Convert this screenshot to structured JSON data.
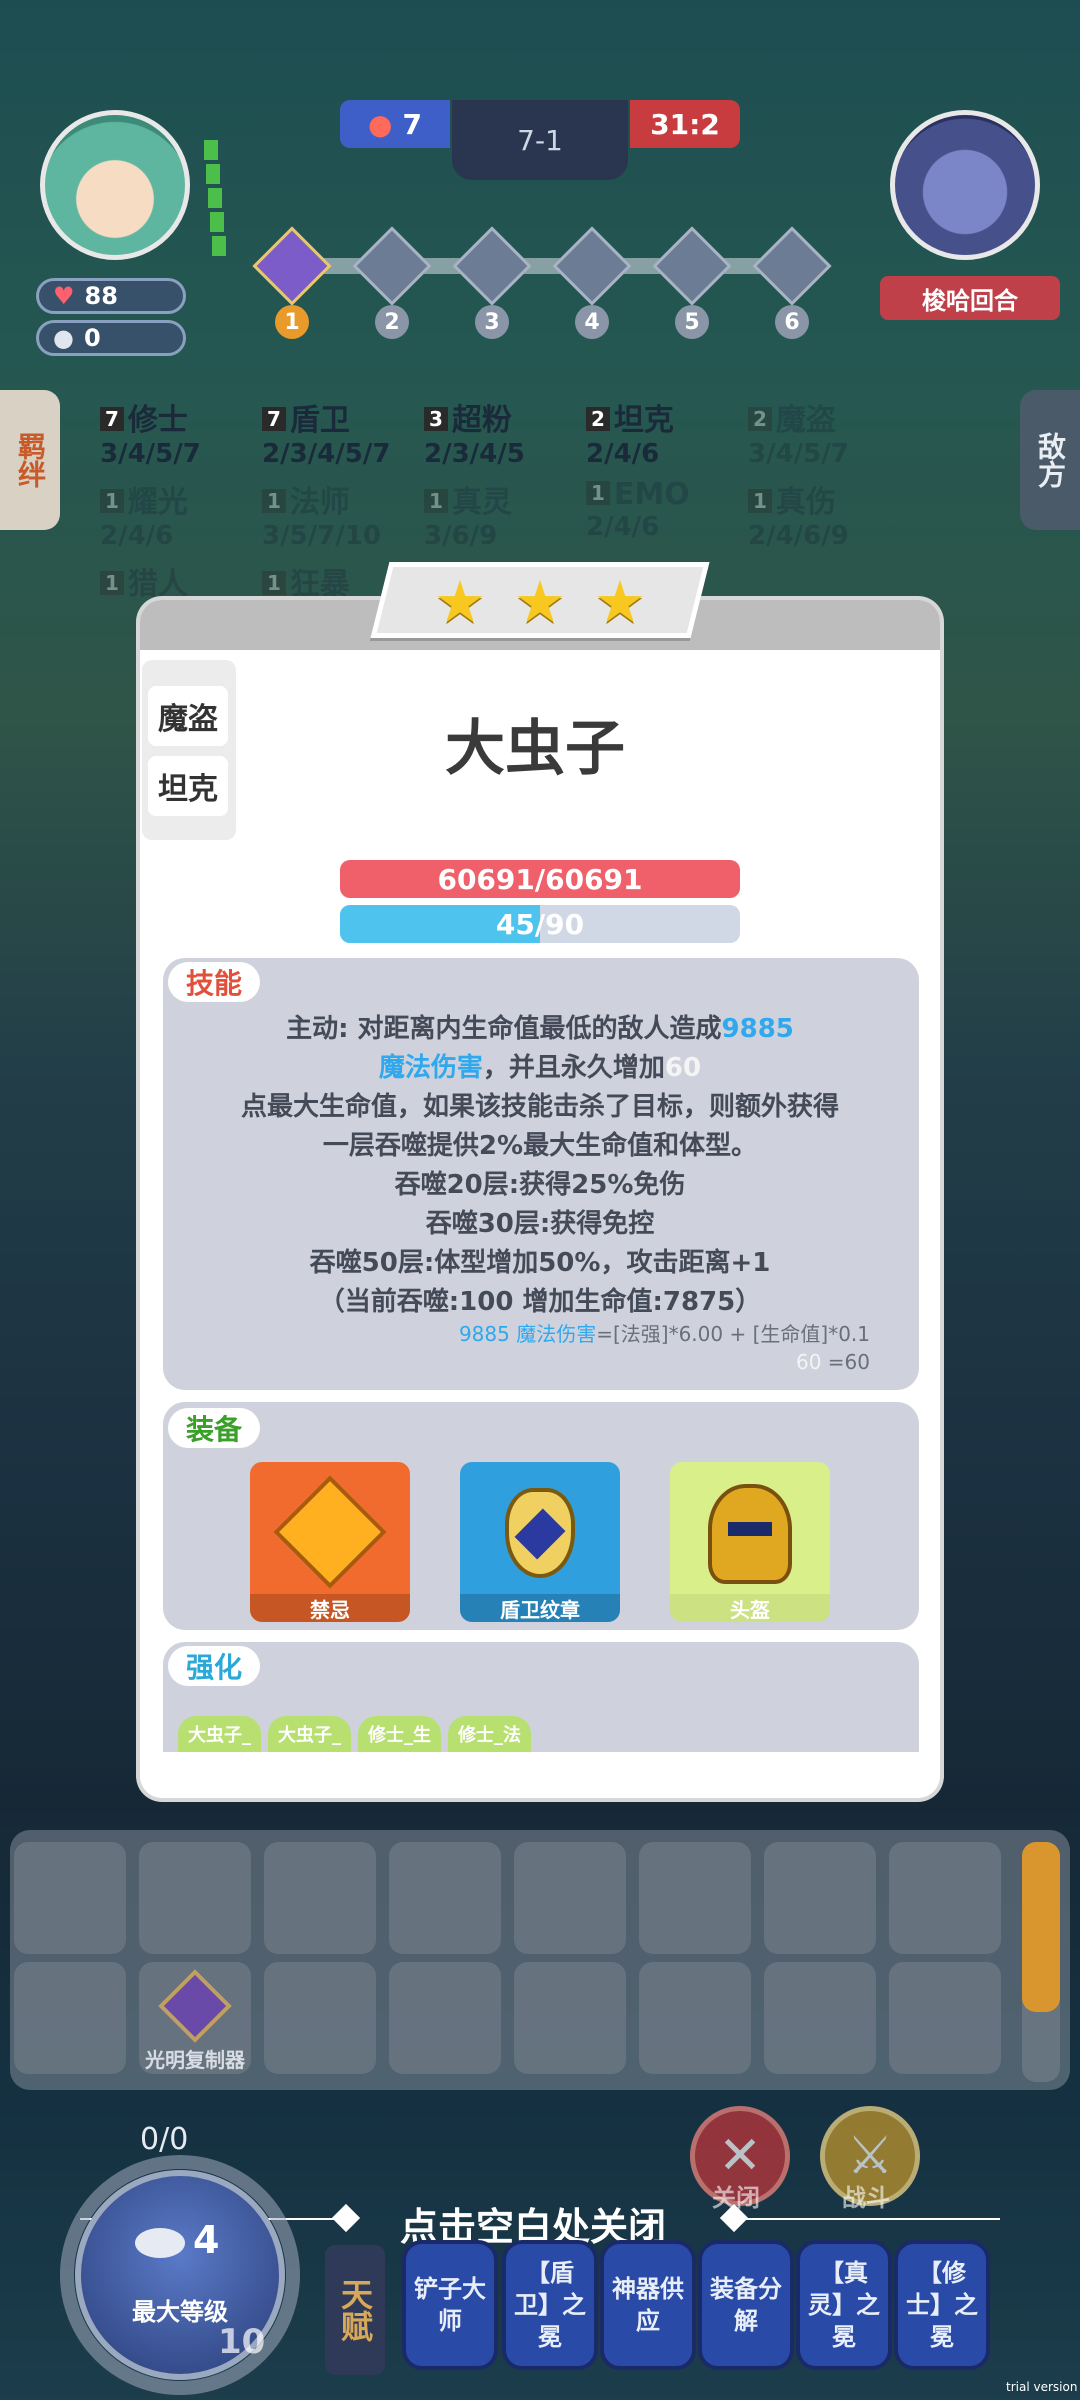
{
  "hud": {
    "player_health": "88",
    "player_gold": "0",
    "blue_score": "7",
    "stage": "7-1",
    "red_score": "31:2",
    "enemy_name": "梭哈回合",
    "round_numbers": [
      "1",
      "2",
      "3",
      "4",
      "5",
      "6"
    ]
  },
  "side_tabs": {
    "left": "羁绊",
    "right": "敌方"
  },
  "traits": [
    {
      "count": "7",
      "name": "修士",
      "levels": "3/4/5/7",
      "faded": false
    },
    {
      "count": "7",
      "name": "盾卫",
      "levels": "2/3/4/5/7",
      "faded": false
    },
    {
      "count": "3",
      "name": "超粉",
      "levels": "2/3/4/5",
      "faded": false
    },
    {
      "count": "2",
      "name": "坦克",
      "levels": "2/4/6",
      "faded": false
    },
    {
      "count": "2",
      "name": "魔盗",
      "levels": "3/4/5/7",
      "faded": true
    },
    {
      "count": "1",
      "name": "耀光",
      "levels": "2/4/6",
      "faded": true
    },
    {
      "count": "1",
      "name": "法师",
      "levels": "3/5/7/10",
      "faded": true
    },
    {
      "count": "1",
      "name": "真灵",
      "levels": "3/6/9",
      "faded": true
    },
    {
      "count": "1",
      "name": "EMO",
      "levels": "2/4/6",
      "faded": true
    },
    {
      "count": "1",
      "name": "真伤",
      "levels": "2/4/6/9",
      "faded": true
    },
    {
      "count": "1",
      "name": "猎人",
      "levels": "",
      "faded": true
    },
    {
      "count": "1",
      "name": "狂暴",
      "levels": "",
      "faded": true
    }
  ],
  "unit": {
    "stars": 3,
    "star_glyph": "★",
    "traits": [
      "魔盗",
      "坦克"
    ],
    "name": "大虫子",
    "hp_text": "60691/60691",
    "mana_text": "45/90",
    "mana_current": 45,
    "mana_max": 90,
    "skill_label": "技能",
    "skill_lines": [
      {
        "text": "主动: 对距离内生命值最低的敌人造成",
        "highlight": "9885"
      },
      {
        "highlight": "魔法伤害",
        "text": "，并且永久增加",
        "trailing": "60"
      },
      {
        "text": "点最大生命值，如果该技能击杀了目标，则额外获得"
      },
      {
        "text": "一层吞噬提供2%最大生命值和体型。"
      },
      {
        "text": "吞噬20层:获得25%免伤"
      },
      {
        "text": "吞噬30层:获得免控"
      },
      {
        "text": "吞噬50层:体型增加50%，攻击距离+1"
      },
      {
        "text": "（当前吞噬:100 增加生命值:7875）"
      }
    ],
    "formula_line1_blue": "9885 魔法伤害",
    "formula_line1_rest": "=[法强]*6.00 + [生命值]*0.1",
    "formula_line2_white": "60",
    "formula_line2_rest": " =60",
    "equip_label": "装备",
    "equipment": [
      {
        "name": "禁忌",
        "color": "#f26b2e",
        "icon": "chain-crystal-icon"
      },
      {
        "name": "盾卫纹章",
        "color": "#2f9fde",
        "icon": "emblem-icon"
      },
      {
        "name": "头盔",
        "color": "#d9f08a",
        "icon": "golden-helmet-icon"
      }
    ],
    "upgrade_label": "强化",
    "upgrades": [
      "大虫子_",
      "大虫子_",
      "修士_生",
      "修士_法"
    ]
  },
  "bench": {
    "item_name": "光明复制器"
  },
  "bottom": {
    "close_label": "关闭",
    "battle_label": "战斗",
    "tap_to_close": "点击空白处关闭",
    "xp_text": "0/0",
    "gold": "4",
    "max_level": "最大等级",
    "level": "10",
    "talent_tab": "天赋",
    "augments": [
      "铲子大师",
      "【盾卫】之冕",
      "神器供应",
      "装备分解",
      "【真灵】之冕",
      "【修士】之冕"
    ]
  },
  "watermark": "trial version"
}
